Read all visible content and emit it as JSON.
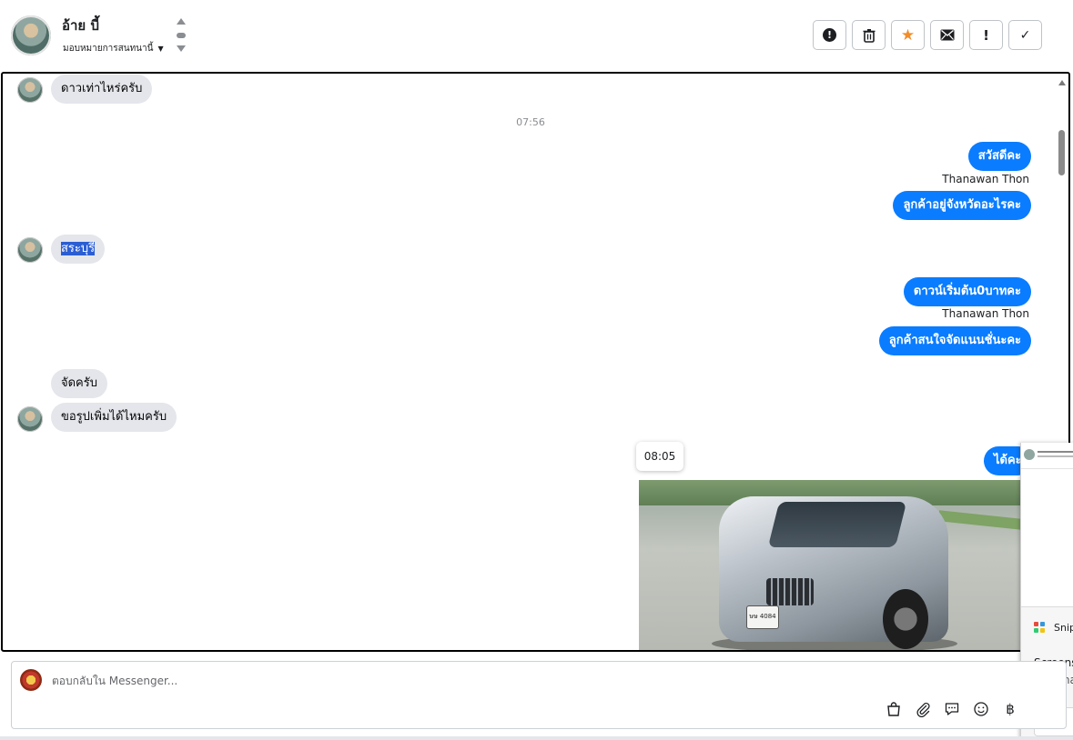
{
  "header": {
    "contact_name": "อ้าย บี้",
    "assign_label": "มอบหมายการสนทนานี้"
  },
  "conversation": {
    "messages": {
      "m1": "ดาวเท่าไหร่ครับ",
      "time1": "07:56",
      "m2": "สวัสดีคะ",
      "m3": "ลูกค้าอยู่จังหวัดอะไรคะ",
      "m4": "สระบุรี",
      "m5": "ดาวน์เริ่มต้น0บาทคะ",
      "m6": "ลูกค้าสนใจจัดแนนชั่นะคะ",
      "m7": "จัดครับ",
      "m8": "ขอรูปเพิ่มได้ไหมครับ",
      "m9": "ได้คะ"
    },
    "sender_name": "Thanawan Thon",
    "tooltip_time": "08:05",
    "plate_text": "ษษ 4084"
  },
  "side_panel": {
    "snip_title": "Snip",
    "line1": "Screens",
    "line2": "Automa"
  },
  "composer": {
    "placeholder": "ตอบกลับใน Messenger...",
    "icons": [
      "bag-icon",
      "paperclip-icon",
      "saved-reply-icon",
      "emoji-icon",
      "baht-icon"
    ],
    "baht_symbol": "฿"
  },
  "colors": {
    "outgoing_bubble": "#0a7cff",
    "incoming_bubble": "#e4e6eb",
    "star": "#f28c28",
    "selection": "#2b5ed3"
  }
}
